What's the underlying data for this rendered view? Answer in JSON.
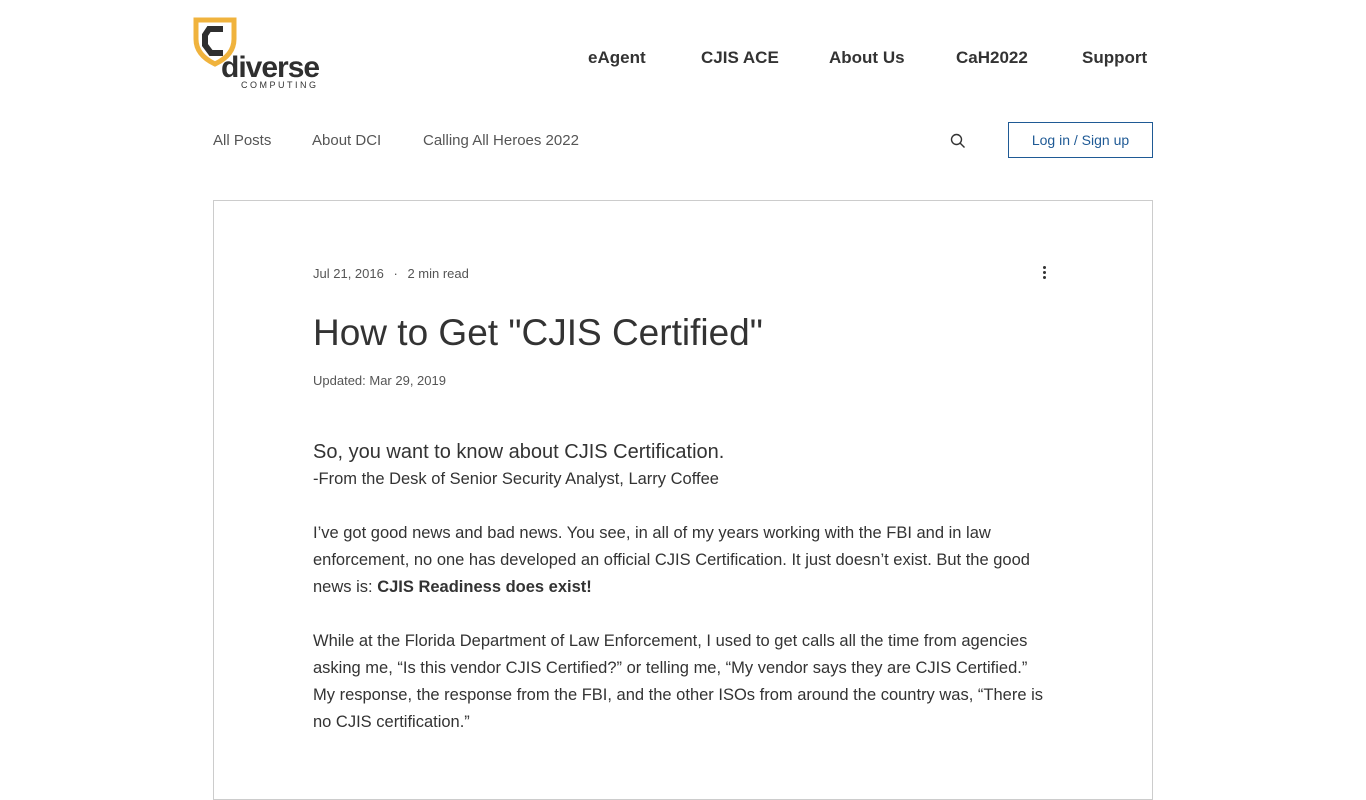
{
  "logo": {
    "brand": "diverse",
    "sub": "COMPUTING",
    "colors": {
      "shield": "#f0b33d",
      "letter": "#2f2f2f"
    }
  },
  "topnav": [
    "eAgent",
    "CJIS ACE",
    "About Us",
    "CaH2022",
    "Support"
  ],
  "blognav": [
    "All Posts",
    "About DCI",
    "Calling All Heroes 2022"
  ],
  "login_label": "Log in / Sign up",
  "post": {
    "date": "Jul 21, 2016",
    "dot": "·",
    "read_time": "2 min read",
    "title": "How to Get \"CJIS Certified\"",
    "updated": "Updated: Mar 29, 2019",
    "heading": "So, you want to know about CJIS Certification.",
    "byline": "-From the Desk of Senior Security Analyst, Larry Coffee",
    "p1": "I’ve got good news and bad news. You see, in all of my years working with the FBI and in law enforcement, no one has developed an official CJIS Certification. It just doesn’t exist. But the good news is: ",
    "p1_bold": "CJIS Readiness does exist!",
    "p2": "While at the Florida Department of Law Enforcement, I used to get calls all the time from agencies asking me, “Is this vendor CJIS Certified?” or telling me, “My vendor says they are CJIS Certified.” My response, the response from the FBI, and the other ISOs from around the country was, “There is no CJIS certification.”"
  }
}
